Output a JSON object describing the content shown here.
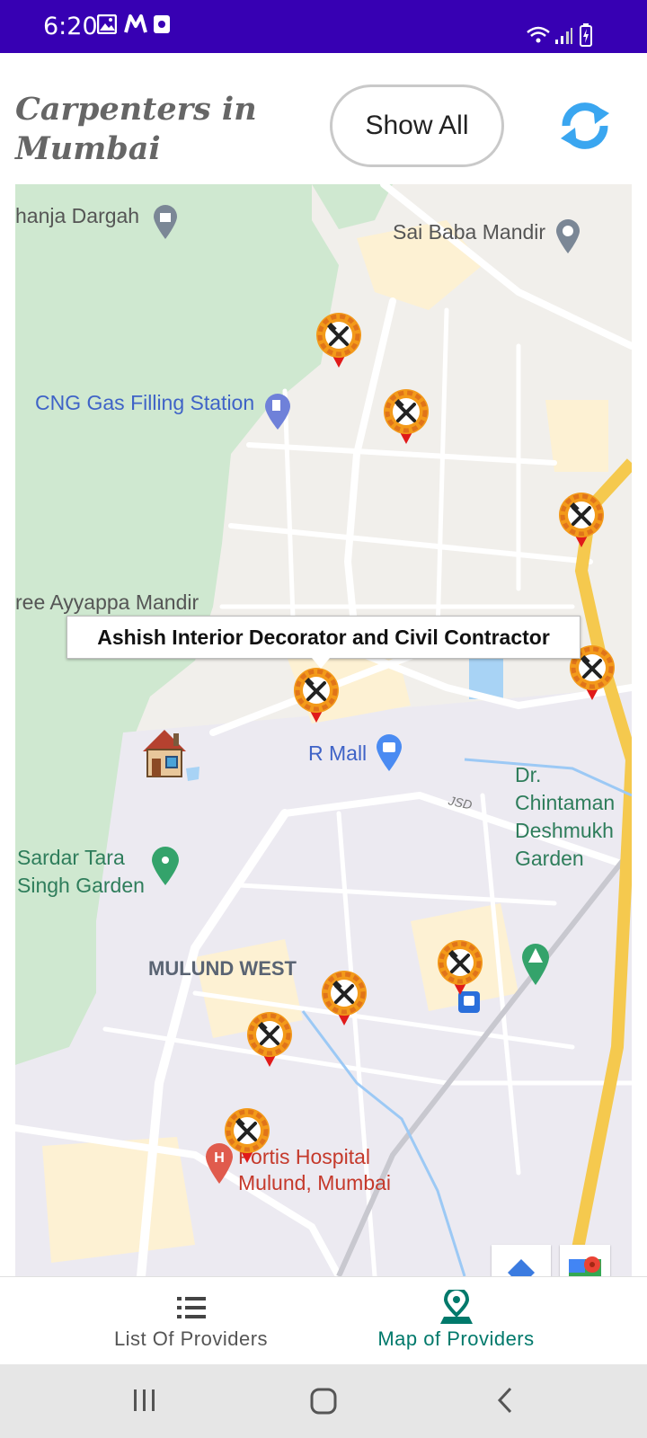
{
  "status_bar": {
    "time": "6:20",
    "background": "#3700b3"
  },
  "header": {
    "title": "Carpenters in Mumbai",
    "show_all_label": "Show All",
    "refresh_icon": "refresh-icon"
  },
  "map": {
    "labels": {
      "dargah": "hanja Dargah",
      "sai_baba": "Sai Baba Mandir",
      "cng": "CNG Gas Filling Station",
      "ayyappa": "ree Ayyappa Mandir",
      "r_mall": "R Mall",
      "chintaman": "Dr.\nChintaman\nDeshmukh\nGarden",
      "sardar": "Sardar Tara\nSingh Garden",
      "mulund_west": "MULUND WEST",
      "fortis": "Fortis Hospital\nMulund, Mumbai",
      "jsd": "JSD"
    },
    "info_window": "Ashish Interior Decorator and Civil Contractor",
    "marker_icon": "carpenter-marker-icon",
    "home_icon": "house-icon"
  },
  "bottom_nav": {
    "list_label": "List Of Providers",
    "map_label": "Map of Providers",
    "active_color": "#00796b"
  }
}
